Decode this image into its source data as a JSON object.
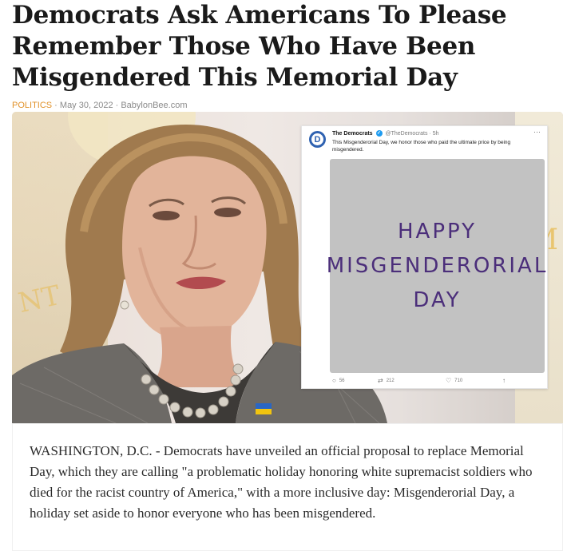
{
  "article": {
    "headline": "Democrats Ask Americans To Please Remember Those Who Have Been Misgendered This Memorial Day",
    "category": "POLITICS",
    "separator": " · ",
    "date": "May 30, 2022",
    "source": "BabylonBee.com",
    "body": "WASHINGTON, D.C. - Democrats have unveiled an official proposal to replace Memorial Day, which they are calling \"a problematic holiday honoring white supremacist soldiers who died for the racist country of America,\" with a more inclusive day: Misgenderorial Day, a holiday set aside to honor everyone who has been misgendered."
  },
  "tweet": {
    "avatar_letter": "D",
    "name": "The Democrats",
    "verified_glyph": "✓",
    "handle": "@TheDemocrats · 5h",
    "more": "···",
    "text": "This Misgenderorial Day, we honor those who paid the ultimate price by being misgendered.",
    "media_text": "HAPPY\nMISGENDERORIAL\nDAY",
    "replies": "56",
    "retweets": "212",
    "likes": "710",
    "icons": {
      "reply": "○",
      "retweet": "⇄",
      "like": "♡",
      "share": "↑"
    }
  },
  "hero_logo": {
    "m": "M",
    "nt": "NT"
  },
  "colors": {
    "category": "#e1922a",
    "tweet_media_bg": "#c2c2c2",
    "tweet_media_text": "#4b2e7a",
    "avatar": "#2f62b1"
  }
}
